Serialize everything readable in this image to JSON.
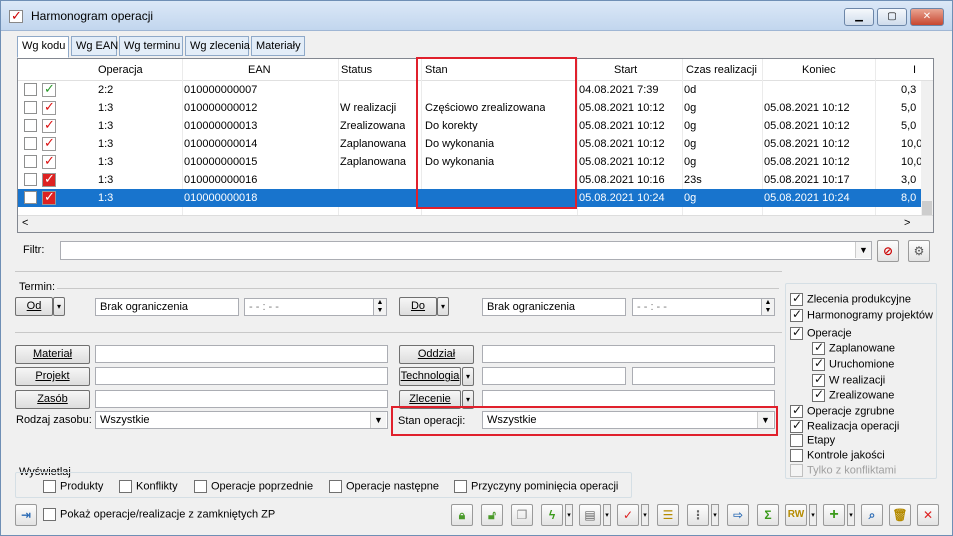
{
  "window": {
    "title": "Harmonogram operacji",
    "minimize": "▁",
    "maximize": "▢",
    "close": "✕"
  },
  "tabs": [
    "Wg kodu",
    "Wg EAN",
    "Wg terminu",
    "Wg zlecenia",
    "Materiały"
  ],
  "grid": {
    "columns": [
      "Operacja",
      "EAN",
      "Status",
      "Stan",
      "Start",
      "Czas realizacji",
      "Koniec",
      "I"
    ],
    "rows": [
      {
        "status_icon": "green-check-icon",
        "op": "2:2",
        "ean": "010000000007",
        "status": "",
        "stan": "",
        "start": "04.08.2021  7:39",
        "czas": "0d",
        "koniec": "",
        "ilosc": "0,3"
      },
      {
        "status_icon": "red-check-icon",
        "op": "1:3",
        "ean": "010000000012",
        "status": "W realizacji",
        "stan": "Częściowo zrealizowana",
        "start": "05.08.2021 10:12",
        "czas": "0g",
        "koniec": "05.08.2021 10:12",
        "ilosc": "5,0"
      },
      {
        "status_icon": "red-check-icon",
        "op": "1:3",
        "ean": "010000000013",
        "status": "Zrealizowana",
        "stan": "Do korekty",
        "start": "05.08.2021 10:12",
        "czas": "0g",
        "koniec": "05.08.2021 10:12",
        "ilosc": "5,0"
      },
      {
        "status_icon": "red-check-icon",
        "op": "1:3",
        "ean": "010000000014",
        "status": "Zaplanowana",
        "stan": "Do wykonania",
        "start": "05.08.2021 10:12",
        "czas": "0g",
        "koniec": "05.08.2021 10:12",
        "ilosc": "10,0"
      },
      {
        "status_icon": "red-check-icon",
        "op": "1:3",
        "ean": "010000000015",
        "status": "Zaplanowana",
        "stan": "Do wykonania",
        "start": "05.08.2021 10:12",
        "czas": "0g",
        "koniec": "05.08.2021 10:12",
        "ilosc": "10,0"
      },
      {
        "status_icon": "red-filled-check-icon",
        "op": "1:3",
        "ean": "010000000016",
        "status": "",
        "stan": "",
        "start": "05.08.2021 10:16",
        "czas": "23s",
        "koniec": "05.08.2021 10:17",
        "ilosc": "3,0"
      },
      {
        "status_icon": "red-filled-check-icon",
        "op": "1:3",
        "ean": "010000000018",
        "status": "",
        "stan": "",
        "start": "05.08.2021 10:24",
        "czas": "0g",
        "koniec": "05.08.2021 10:24",
        "ilosc": "8,0",
        "selected": true
      }
    ]
  },
  "filter": {
    "label": "Filtr:",
    "value": ""
  },
  "termin": {
    "label": "Termin:",
    "od_button": "Od",
    "od_value": "Brak ograniczenia",
    "od_time": "- - : - -",
    "do_button": "Do",
    "do_value": "Brak ograniczenia",
    "do_time": "- - : - -"
  },
  "form": {
    "material_button": "Materiał",
    "projekt_button": "Projekt",
    "zasob_button": "Zasób",
    "rodzaj_label": "Rodzaj zasobu:",
    "rodzaj_value": "Wszystkie",
    "oddzial_button": "Oddział",
    "technologia_button": "Technologia",
    "zlecenie_button": "Zlecenie",
    "stan_label": "Stan operacji:",
    "stan_value": "Wszystkie"
  },
  "right_checks": [
    {
      "label": "Zlecenia produkcyjne",
      "checked": true
    },
    {
      "label": "Harmonogramy projektów",
      "checked": true
    },
    {
      "label": "Operacje",
      "checked": true
    },
    {
      "label": "Zaplanowane",
      "checked": true,
      "indent": true
    },
    {
      "label": "Uruchomione",
      "checked": true,
      "indent": true
    },
    {
      "label": "W realizacji",
      "checked": true,
      "indent": true
    },
    {
      "label": "Zrealizowane",
      "checked": true,
      "indent": true
    },
    {
      "label": "Operacje zgrubne",
      "checked": true
    },
    {
      "label": "Realizacja operacji",
      "checked": true
    },
    {
      "label": "Etapy",
      "checked": false
    },
    {
      "label": "Kontrole jakości",
      "checked": false
    },
    {
      "label": "Tylko z konfliktami",
      "checked": false,
      "disabled": true
    }
  ],
  "wyswietlaj": {
    "label": "Wyświetlaj",
    "items": [
      {
        "label": "Produkty",
        "checked": false
      },
      {
        "label": "Konflikty",
        "checked": false
      },
      {
        "label": "Operacje poprzednie",
        "checked": false
      },
      {
        "label": "Operacje następne",
        "checked": false
      },
      {
        "label": "Przyczyny pominięcia operacji",
        "checked": false
      }
    ]
  },
  "bottom": {
    "show_closed_label": "Pokaż operacje/realizacje z zamkniętych ZP",
    "show_closed_checked": false
  },
  "toolbar": [
    "lock-icon",
    "unlock-icon",
    "copy-icon",
    "lightning-icon",
    "plan-icon",
    "check-red-icon",
    "table-icon",
    "tree-icon",
    "export-icon",
    "sum-icon",
    "rw-icon",
    "add-icon",
    "search-icon",
    "delete-icon",
    "close-icon"
  ],
  "toolbar_text": {
    "sum": "Σ",
    "rw": "RW",
    "add": "+",
    "close": "✕"
  }
}
